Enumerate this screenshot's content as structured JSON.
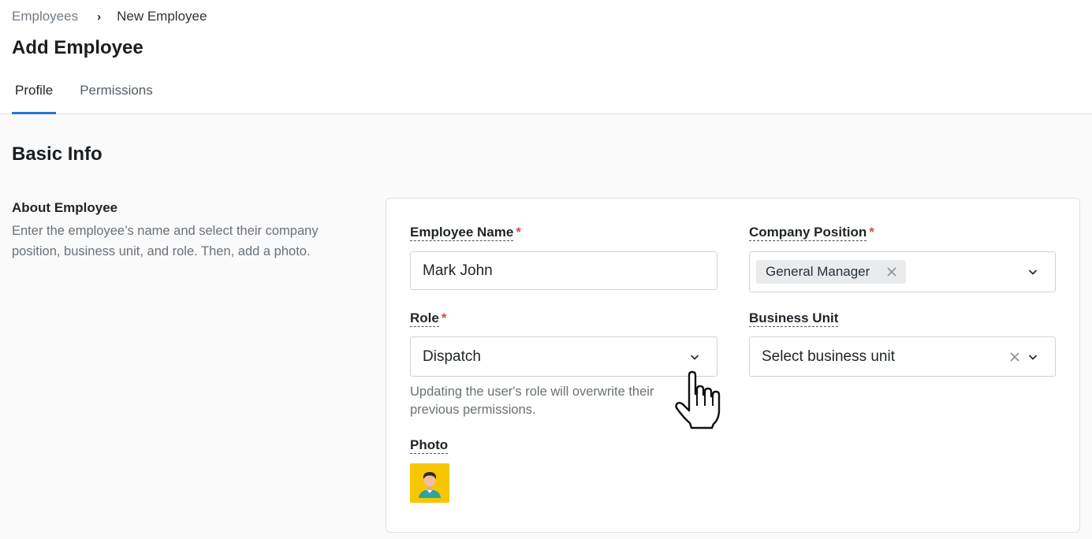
{
  "breadcrumb": {
    "parent": "Employees",
    "current": "New Employee"
  },
  "page": {
    "title": "Add Employee"
  },
  "tabs": [
    {
      "label": "Profile",
      "active": true
    },
    {
      "label": "Permissions",
      "active": false
    }
  ],
  "section": {
    "title": "Basic Info"
  },
  "about": {
    "title": "About Employee",
    "description": "Enter the employee’s name and select their company position, business unit, and role. Then, add a photo."
  },
  "form": {
    "employee_name": {
      "label": "Employee Name",
      "required_mark": "*",
      "value": "Mark John"
    },
    "company_position": {
      "label": "Company Position",
      "required_mark": "*",
      "selected": "General Manager"
    },
    "role": {
      "label": "Role",
      "required_mark": "*",
      "value": "Dispatch",
      "helper": "Updating the user's role will overwrite their previous permissions."
    },
    "business_unit": {
      "label": "Business Unit",
      "placeholder": "Select business unit"
    },
    "photo": {
      "label": "Photo"
    }
  },
  "colors": {
    "accent": "#2a75d4",
    "required": "#e04747",
    "photo_bg": "#f7c600"
  },
  "icons": [
    "chevron-right-icon",
    "chevron-down-icon",
    "close-icon",
    "avatar-icon",
    "hand-pointer-cursor-icon"
  ]
}
